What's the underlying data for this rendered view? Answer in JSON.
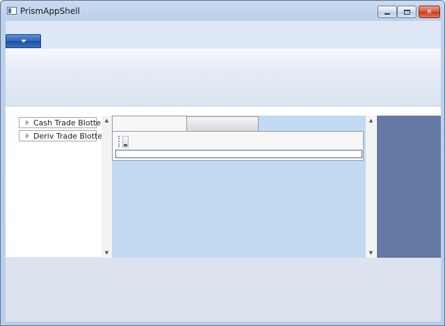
{
  "window": {
    "title": "PrismAppShell",
    "controls": {
      "minimize": "",
      "maximize": "",
      "close": "✕"
    }
  },
  "navigation": {
    "items": [
      {
        "label": "Cash Trade Blotter"
      },
      {
        "label": "Deriv Trade Blotter"
      }
    ]
  },
  "scrollbars": {
    "up_arrow": "▲",
    "down_arrow": "▼"
  },
  "colors": {
    "document_area": "#c2daf2",
    "side_panel": "#6679a4",
    "app_menu_button": "#2f63b6"
  }
}
